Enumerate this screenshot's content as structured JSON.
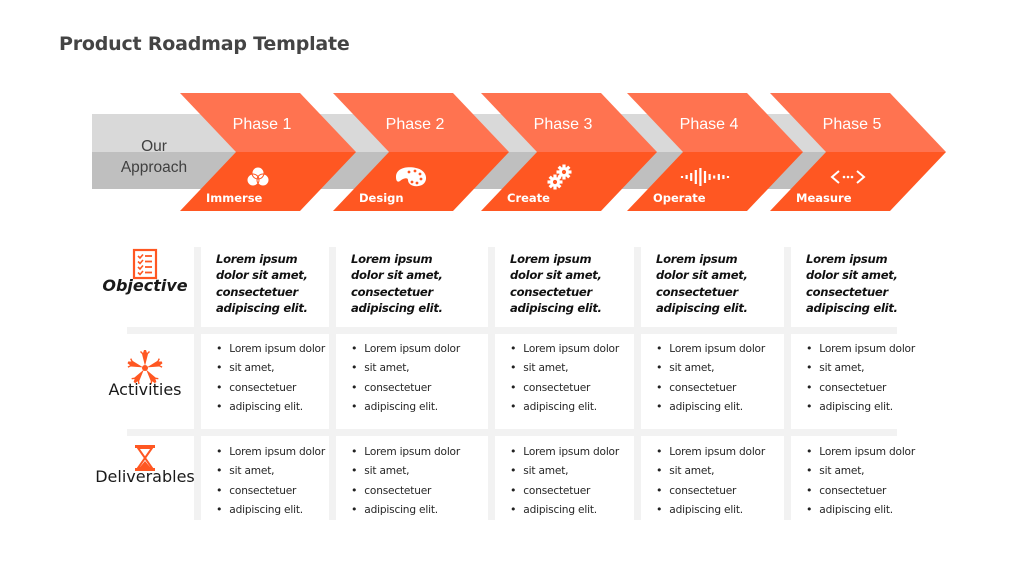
{
  "title": "Product Roadmap Template",
  "colors": {
    "accent_light": "#ff7350",
    "accent_dark": "#ff5722",
    "band_light": "#d9d9d9",
    "band_dark": "#bfbfbf",
    "grid_line": "#f2f2f2"
  },
  "approach": {
    "line1": "Our",
    "line2": "Approach"
  },
  "phases": [
    {
      "label": "Phase 1",
      "stage": "Immerse",
      "icon": "venn-circles-icon"
    },
    {
      "label": "Phase 2",
      "stage": "Design",
      "icon": "palette-icon"
    },
    {
      "label": "Phase 3",
      "stage": "Create",
      "icon": "gears-icon"
    },
    {
      "label": "Phase 4",
      "stage": "Operate",
      "icon": "sound-wave-icon"
    },
    {
      "label": "Phase 5",
      "stage": "Measure",
      "icon": "code-brackets-icon"
    }
  ],
  "rows": [
    {
      "label": "Objective",
      "icon": "checklist-icon"
    },
    {
      "label": "Activities",
      "icon": "team-hands-icon"
    },
    {
      "label": "Deliverables",
      "icon": "hourglass-icon"
    }
  ],
  "objectives": [
    [
      "Lorem ipsum",
      "dolor sit amet,",
      "consectetuer",
      "adipiscing elit."
    ],
    [
      "Lorem ipsum",
      "dolor sit amet,",
      "consectetuer",
      "adipiscing elit."
    ],
    [
      "Lorem ipsum",
      "dolor sit amet,",
      "consectetuer",
      "adipiscing elit."
    ],
    [
      "Lorem ipsum",
      "dolor sit amet,",
      "consectetuer",
      "adipiscing elit."
    ],
    [
      "Lorem ipsum",
      "dolor sit amet,",
      "consectetuer",
      "adipiscing elit."
    ]
  ],
  "activities": [
    [
      "Lorem ipsum dolor",
      "sit amet,",
      "consectetuer",
      "adipiscing elit."
    ],
    [
      "Lorem ipsum dolor",
      "sit amet,",
      "consectetuer",
      "adipiscing elit."
    ],
    [
      "Lorem ipsum dolor",
      "sit amet,",
      "consectetuer",
      "adipiscing elit."
    ],
    [
      "Lorem ipsum dolor",
      "sit amet,",
      "consectetuer",
      "adipiscing elit."
    ],
    [
      "Lorem ipsum dolor",
      "sit amet,",
      "consectetuer",
      "adipiscing elit."
    ]
  ],
  "deliverables": [
    [
      "Lorem ipsum dolor",
      "sit amet,",
      "consectetuer",
      "adipiscing elit."
    ],
    [
      "Lorem ipsum dolor",
      "sit amet,",
      "consectetuer",
      "adipiscing elit."
    ],
    [
      "Lorem ipsum dolor",
      "sit amet,",
      "consectetuer",
      "adipiscing elit."
    ],
    [
      "Lorem ipsum dolor",
      "sit amet,",
      "consectetuer",
      "adipiscing elit."
    ],
    [
      "Lorem ipsum dolor",
      "sit amet,",
      "consectetuer",
      "adipiscing elit."
    ]
  ]
}
